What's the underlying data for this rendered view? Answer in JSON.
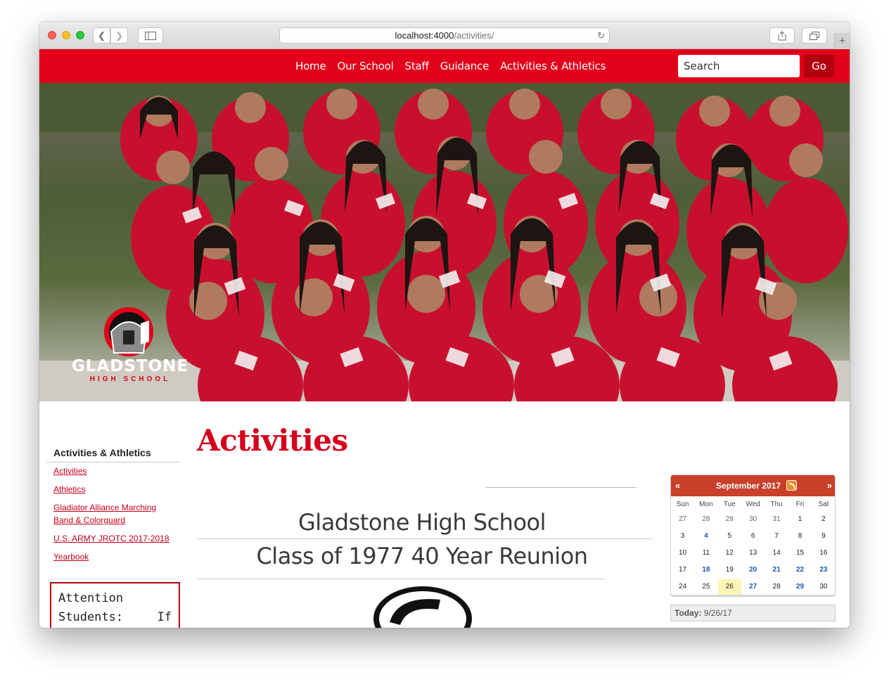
{
  "browser": {
    "url_host": "localhost:4000",
    "url_path": "/activities/"
  },
  "nav": {
    "items": [
      "Home",
      "Our School",
      "Staff",
      "Guidance",
      "Activities & Athletics"
    ],
    "search_placeholder": "Search",
    "go_label": "Go"
  },
  "logo": {
    "name": "GLADSTONE",
    "sub": "HIGH SCHOOL"
  },
  "sidebar": {
    "title": "Activities & Athletics",
    "links": [
      "Activities",
      "Athletics",
      "Gladiator Alliance Marching Band & Colorguard",
      "U.S. ARMY JROTC 2017-2018",
      "Yearbook"
    ],
    "notice": "Attention Students: If you"
  },
  "main": {
    "title": "Activities",
    "flyer_line1": "Gladstone High School",
    "flyer_line2": "Class of 1977 40 Year Reunion"
  },
  "calendar": {
    "prev": "«",
    "next": "»",
    "month": "September 2017",
    "weekdays": [
      "Sun",
      "Mon",
      "Tue",
      "Wed",
      "Thu",
      "Fri",
      "Sat"
    ],
    "weeks": [
      [
        "27",
        "28",
        "29",
        "30",
        "31",
        "1",
        "2"
      ],
      [
        "3",
        "4",
        "5",
        "6",
        "7",
        "8",
        "9"
      ],
      [
        "10",
        "11",
        "12",
        "13",
        "14",
        "15",
        "16"
      ],
      [
        "17",
        "18",
        "19",
        "20",
        "21",
        "22",
        "23"
      ],
      [
        "24",
        "25",
        "26",
        "27",
        "28",
        "29",
        "30"
      ]
    ],
    "event_days": [
      "4",
      "18",
      "20",
      "21",
      "22",
      "23",
      "27",
      "29"
    ],
    "today_label": "Today:",
    "today_value": "9/26/17"
  },
  "colors": {
    "brand_red": "#e2001a",
    "calendar_header": "#c9402a",
    "event_blue": "#1a55b3"
  }
}
